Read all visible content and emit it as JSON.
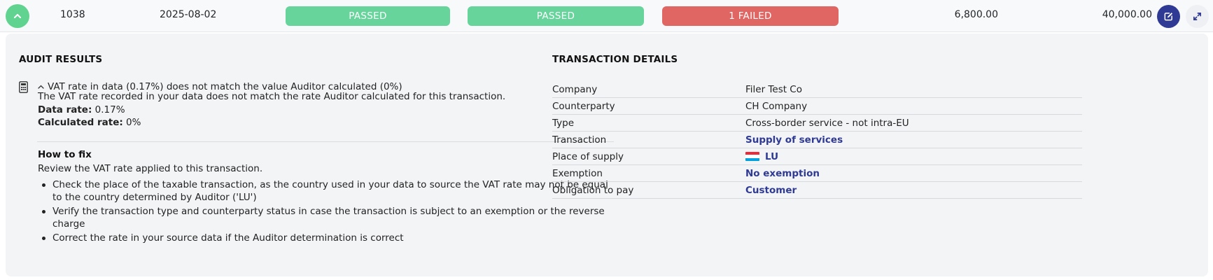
{
  "row": {
    "id": "1038",
    "date": "2025-08-02",
    "check1": "PASSED",
    "check2": "PASSED",
    "check3": "1 FAILED",
    "amount1": "6,800.00",
    "amount2": "40,000.00"
  },
  "colors": {
    "passed": "#66d49b",
    "failed": "#e06664",
    "accent": "#2e3a93",
    "expand": "#5fd38f"
  },
  "icons": {
    "expand": "chevron-up-icon",
    "edit": "edit-icon",
    "fullscreen": "expand-arrows-icon",
    "audit": "calculator-icon",
    "collapse": "chevron-up-icon"
  },
  "audit": {
    "title": "AUDIT RESULTS",
    "issue_title": "VAT rate in data (0.17%) does not match the value Auditor calculated (0%)",
    "description": "The VAT rate recorded in your data does not match the rate Auditor calculated for this transaction.",
    "data_rate_label": "Data rate:",
    "data_rate_value": "0.17%",
    "calc_rate_label": "Calculated rate:",
    "calc_rate_value": "0%",
    "fix_title": "How to fix",
    "fix_intro": "Review the VAT rate applied to this transaction.",
    "fix_items": [
      "Check the place of the taxable transaction, as the country used in your data to source the VAT rate may not be equal to the country determined by Auditor ('LU')",
      "Verify the transaction type and counterparty status in case the transaction is subject to an exemption or the reverse charge",
      "Correct the rate in your source data if the Auditor determination is correct"
    ]
  },
  "details": {
    "title": "TRANSACTION DETAILS",
    "rows": [
      {
        "label": "Company",
        "value": "Filer Test Co"
      },
      {
        "label": "Counterparty",
        "value": "CH Company"
      },
      {
        "label": "Type",
        "value": "Cross-border service - not intra-EU"
      },
      {
        "label": "Transaction",
        "value": "Supply of services"
      },
      {
        "label": "Place of supply",
        "value": "LU",
        "flag": "luxembourg-flag-icon"
      },
      {
        "label": "Exemption",
        "value": "No exemption"
      },
      {
        "label": "Obligation to pay",
        "value": "Customer"
      }
    ]
  }
}
